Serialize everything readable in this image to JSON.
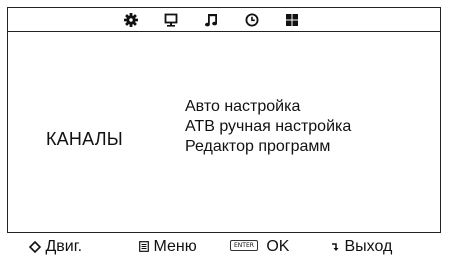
{
  "top_tabs": [
    {
      "icon": "gear-icon"
    },
    {
      "icon": "monitor-icon"
    },
    {
      "icon": "music-note-icon"
    },
    {
      "icon": "clock-icon"
    },
    {
      "icon": "grid-icon"
    }
  ],
  "category": {
    "label": "КАНАЛЫ"
  },
  "menu": {
    "items": [
      {
        "label": "Авто настройка"
      },
      {
        "label": "АТВ ручная настройка"
      },
      {
        "label": "Редактор программ"
      }
    ]
  },
  "footer": {
    "move": {
      "icon": "dpad-icon",
      "label": "Двиг."
    },
    "menu": {
      "icon": "menu-icon",
      "label": "Меню"
    },
    "ok": {
      "key": "ENTER",
      "label": "OK"
    },
    "exit": {
      "icon": "return-icon",
      "label": "Выход"
    }
  },
  "colors": {
    "text": "#111111",
    "background": "#ffffff",
    "border": "#222222"
  }
}
